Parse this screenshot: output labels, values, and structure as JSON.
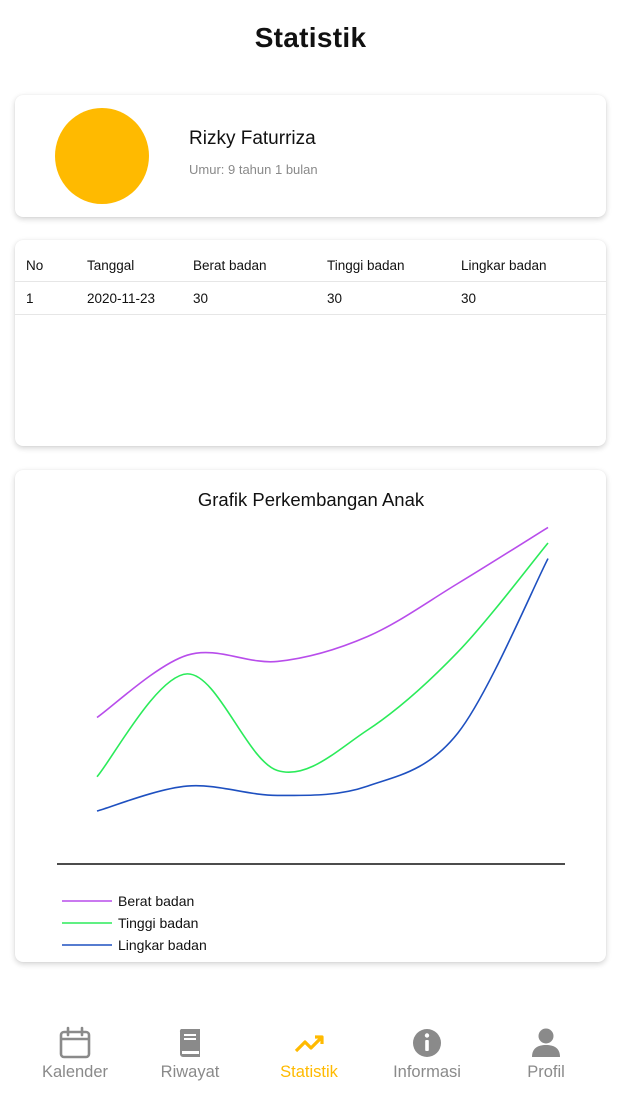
{
  "header": {
    "title": "Statistik"
  },
  "profile": {
    "name": "Rizky Faturriza",
    "age": "Umur: 9 tahun 1 bulan",
    "avatar_color": "#FFBA00"
  },
  "table": {
    "headers": [
      "No",
      "Tanggal",
      "Berat badan",
      "Tinggi badan",
      "Lingkar badan"
    ],
    "rows": [
      [
        "1",
        "2020-11-23",
        "30",
        "30",
        "30"
      ]
    ]
  },
  "chart_data": {
    "type": "line",
    "title": "Grafik Perkembangan Anak",
    "x": [
      0,
      1,
      2,
      3,
      4,
      5
    ],
    "series": [
      {
        "name": "Berat badan",
        "color": "#B84DEB",
        "values": [
          47,
          67,
          65,
          73,
          90,
          108
        ]
      },
      {
        "name": "Tinggi badan",
        "color": "#2BEB5A",
        "values": [
          28,
          61,
          30,
          43,
          68,
          103
        ]
      },
      {
        "name": "Lingkar badan",
        "color": "#1E50C0",
        "values": [
          17,
          25,
          22,
          25,
          42,
          98
        ]
      }
    ],
    "ylim": [
      0,
      120
    ],
    "grid": false,
    "legend": "bottom-left",
    "axis_line": "x only"
  },
  "nav": {
    "items": [
      {
        "label": "Kalender",
        "icon": "calendar-icon"
      },
      {
        "label": "Riwayat",
        "icon": "book-icon"
      },
      {
        "label": "Statistik",
        "icon": "trending-up-icon"
      },
      {
        "label": "Informasi",
        "icon": "info-icon"
      },
      {
        "label": "Profil",
        "icon": "person-icon"
      }
    ],
    "active": "Statistik",
    "active_color": "#FFBA00",
    "inactive_color": "#8a8a8a"
  }
}
